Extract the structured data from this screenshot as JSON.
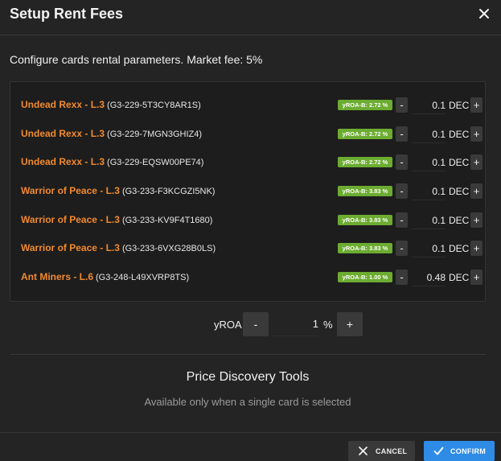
{
  "dialog": {
    "title": "Setup Rent Fees",
    "intro": "Configure cards rental parameters. Market fee: 5%"
  },
  "cards": [
    {
      "name": "Undead Rexx - L.3",
      "id": "(G3-229-5T3CY8AR1S)",
      "badge": "yROA-B: 2.72 %",
      "value": "0.1",
      "unit": "DEC",
      "minus": "-",
      "plus": "+"
    },
    {
      "name": "Undead Rexx - L.3",
      "id": "(G3-229-7MGN3GHIZ4)",
      "badge": "yROA-B: 2.72 %",
      "value": "0.1",
      "unit": "DEC",
      "minus": "-",
      "plus": "+"
    },
    {
      "name": "Undead Rexx - L.3",
      "id": "(G3-229-EQSW00PE74)",
      "badge": "yROA-B: 2.72 %",
      "value": "0.1",
      "unit": "DEC",
      "minus": "-",
      "plus": "+"
    },
    {
      "name": "Warrior of Peace - L.3",
      "id": "(G3-233-F3KCGZI5NK)",
      "badge": "yROA-B: 3.83 %",
      "value": "0.1",
      "unit": "DEC",
      "minus": "-",
      "plus": "+"
    },
    {
      "name": "Warrior of Peace - L.3",
      "id": "(G3-233-KV9F4T1680)",
      "badge": "yROA-B: 3.83 %",
      "value": "0.1",
      "unit": "DEC",
      "minus": "-",
      "plus": "+"
    },
    {
      "name": "Warrior of Peace - L.3",
      "id": "(G3-233-6VXG28B0LS)",
      "badge": "yROA-B: 3.83 %",
      "value": "0.1",
      "unit": "DEC",
      "minus": "-",
      "plus": "+"
    },
    {
      "name": "Ant Miners - L.6",
      "id": "(G3-248-L49XVRP8TS)",
      "badge": "yROA-B: 1.00 %",
      "value": "0.48",
      "unit": "DEC",
      "minus": "-",
      "plus": "+"
    }
  ],
  "yroa": {
    "label": "yROA",
    "value": "1",
    "unit": "%",
    "minus": "-",
    "plus": "+"
  },
  "price_discovery": {
    "title": "Price Discovery Tools",
    "subtitle": "Available only when a single card is selected"
  },
  "footer": {
    "cancel_label": "CANCEL",
    "confirm_label": "CONFIRM"
  },
  "colors": {
    "background": "#242424",
    "card_name": "#f28a2e",
    "badge": "#6cac31",
    "confirm": "#2e8be6"
  },
  "icons": {
    "close": "close-icon",
    "cancel": "x-icon",
    "confirm": "check-icon"
  }
}
